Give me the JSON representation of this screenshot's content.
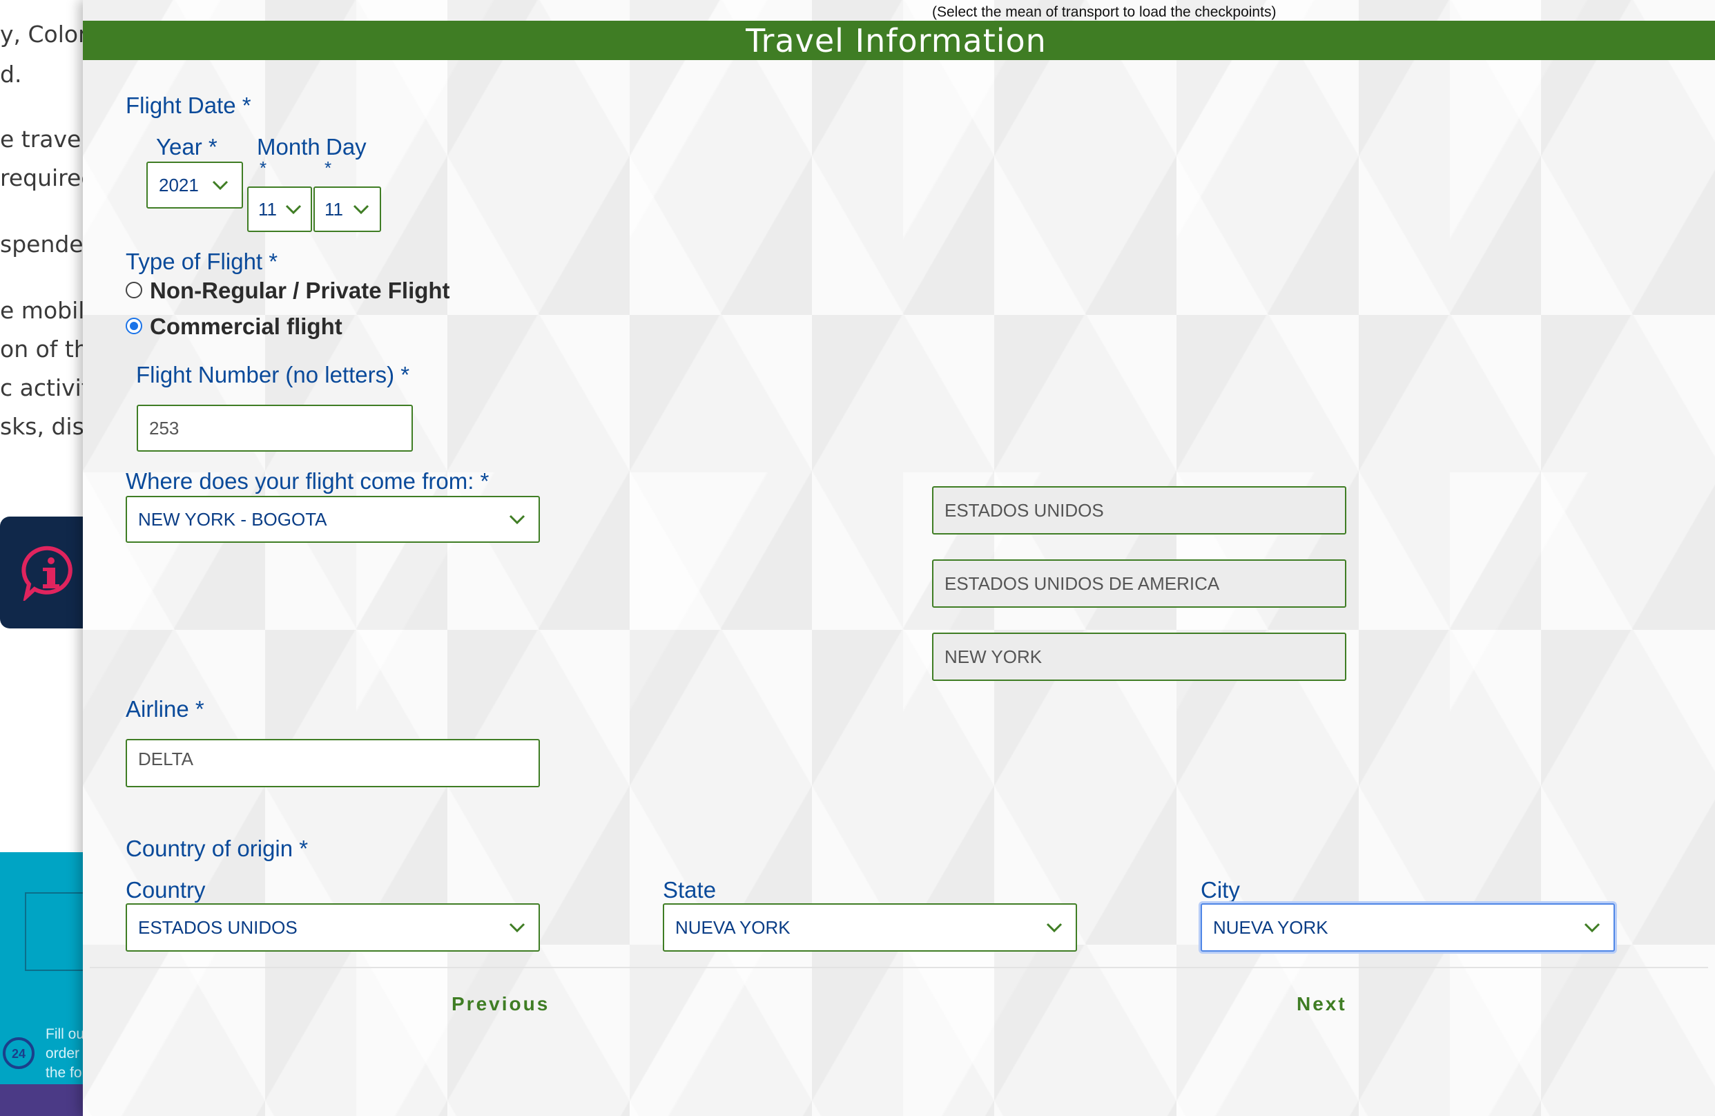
{
  "background_page": {
    "lines": [
      "y, Colom",
      "d.",
      "e travelir",
      " required",
      "spended",
      "e mobilit",
      "on of the",
      "c activit",
      "sks, dist"
    ],
    "footer_text": [
      "Fill ou",
      "order",
      "the fo"
    ],
    "badge_24": "24"
  },
  "modal": {
    "hint": "(Select the mean of transport to load the checkpoints)",
    "title": "Travel Information",
    "flight_date": {
      "label": "Flight Date *",
      "year_label": "Year *",
      "month_label": "Month",
      "month_required": "*",
      "day_label": "Day",
      "day_required": "*",
      "year_value": "2021",
      "month_value": "11",
      "day_value": "11"
    },
    "flight_type": {
      "label": "Type of Flight *",
      "options": [
        "Non-Regular / Private Flight",
        "Commercial flight"
      ],
      "selected": "Commercial flight"
    },
    "flight_number": {
      "label": "Flight Number (no letters) *",
      "value": "253"
    },
    "origin_route": {
      "label": "Where does your flight come from: *",
      "value": "NEW YORK - BOGOTA"
    },
    "route_details": {
      "country": "ESTADOS UNIDOS",
      "country_full": "ESTADOS UNIDOS DE AMERICA",
      "city": "NEW YORK"
    },
    "airline": {
      "label": "Airline *",
      "value": "DELTA"
    },
    "country_of_origin": {
      "label": "Country of origin *",
      "country_label": "Country",
      "country_value": "ESTADOS UNIDOS",
      "state_label": "State",
      "state_value": "NUEVA YORK",
      "city_label": "City",
      "city_value": "NUEVA YORK"
    },
    "nav": {
      "previous": "Previous",
      "next": "Next"
    }
  },
  "colors": {
    "accent_green": "#3f7d24",
    "label_blue": "#0a4a9a",
    "focus_blue": "#4f86e6"
  }
}
